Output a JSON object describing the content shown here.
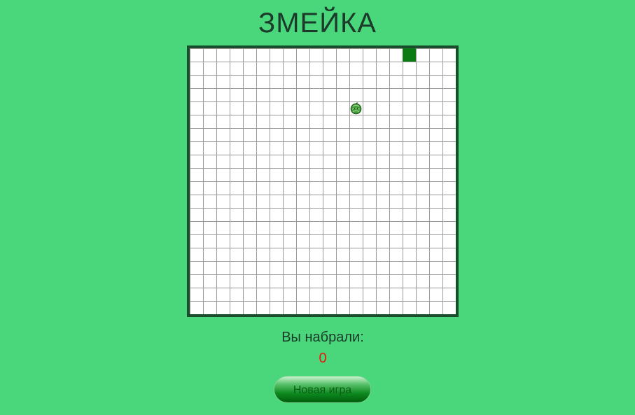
{
  "header": {
    "title": "ЗМЕЙКА"
  },
  "board": {
    "grid_cols": 20,
    "grid_rows": 20,
    "snake": [
      {
        "col": 16,
        "row": 0
      }
    ],
    "food": {
      "col": 12,
      "row": 4,
      "icon": "watermelon-icon"
    },
    "colors": {
      "snake": "#0a7a13",
      "border": "#1a4d2c",
      "background": "#4ad67a"
    }
  },
  "score": {
    "label": "Вы набрали:",
    "value": "0",
    "value_color": "#e8170f"
  },
  "controls": {
    "new_game_label": "Новая игра"
  }
}
